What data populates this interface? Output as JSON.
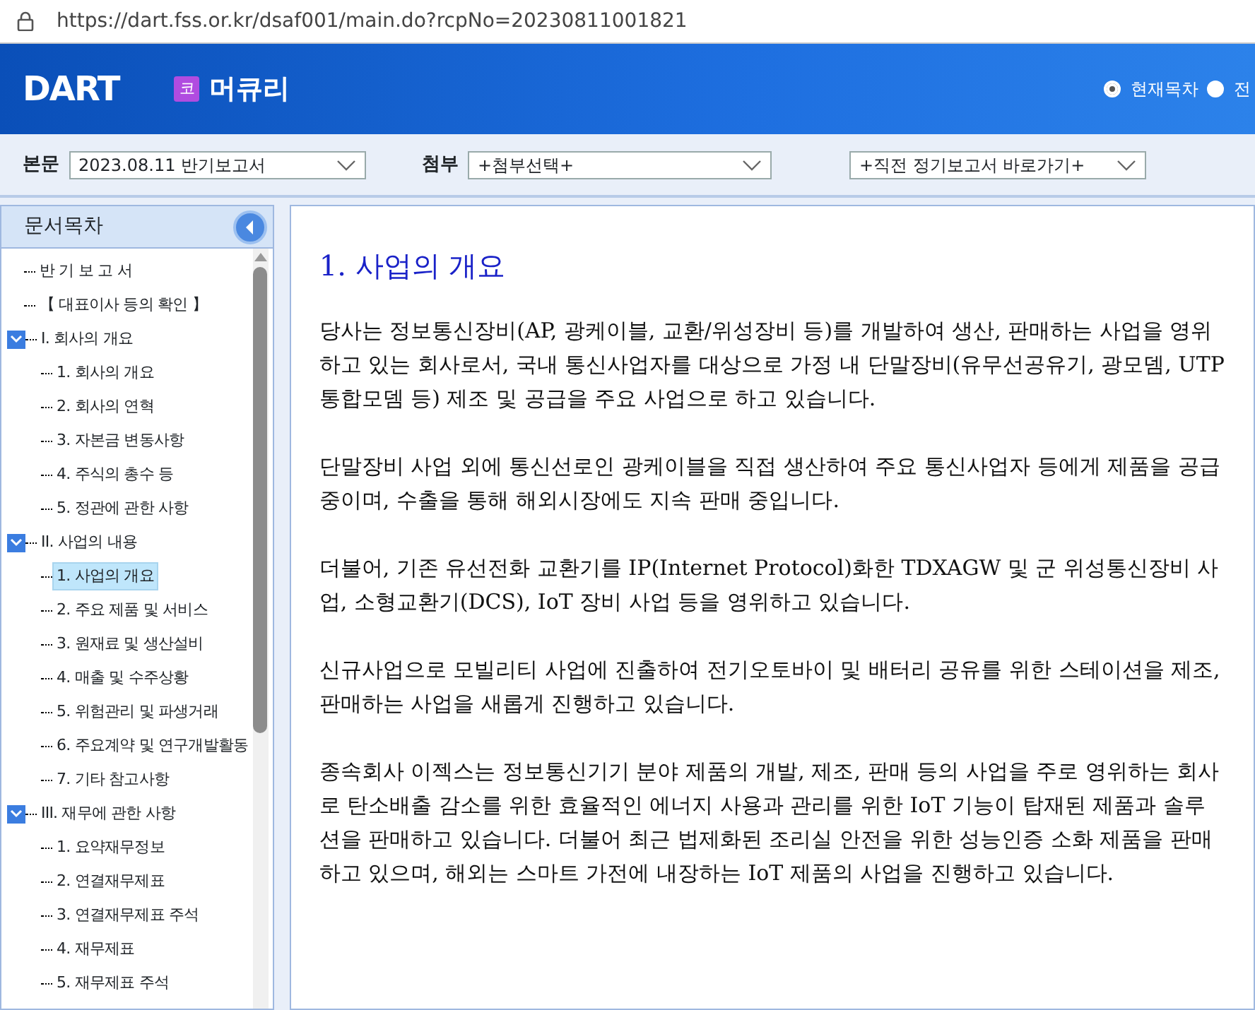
{
  "address_bar": {
    "url": "https://dart.fss.or.kr/dsaf001/main.do?rcpNo=20230811001821"
  },
  "header": {
    "logo": "DART",
    "company_badge": "코",
    "company": "머큐리",
    "view_options": [
      {
        "label": "현재목차",
        "selected": true
      },
      {
        "label": "전",
        "selected": false
      }
    ]
  },
  "selectors": [
    {
      "label": "본문",
      "value": "2023.08.11  반기보고서"
    },
    {
      "label": "첨부",
      "value": "+첨부선택+"
    },
    {
      "value": "+직전 정기보고서 바로가기+"
    }
  ],
  "sidebar": {
    "title": "문서목차",
    "items": [
      {
        "label": "반 기 보 고 서",
        "selected": false
      },
      {
        "label": "【 대표이사 등의 확인 】",
        "selected": false
      },
      {
        "label": "I. 회사의 개요",
        "selected": false,
        "expanded": true,
        "children": [
          {
            "label": "1. 회사의 개요",
            "selected": false
          },
          {
            "label": "2. 회사의 연혁",
            "selected": false
          },
          {
            "label": "3. 자본금 변동사항",
            "selected": false
          },
          {
            "label": "4. 주식의 총수 등",
            "selected": false
          },
          {
            "label": "5. 정관에 관한 사항",
            "selected": false
          }
        ]
      },
      {
        "label": "II. 사업의 내용",
        "selected": false,
        "expanded": true,
        "children": [
          {
            "label": "1. 사업의 개요",
            "selected": true
          },
          {
            "label": "2. 주요 제품 및 서비스",
            "selected": false
          },
          {
            "label": "3. 원재료 및 생산설비",
            "selected": false
          },
          {
            "label": "4. 매출 및 수주상황",
            "selected": false
          },
          {
            "label": "5. 위험관리 및 파생거래",
            "selected": false
          },
          {
            "label": "6. 주요계약 및 연구개발활동",
            "selected": false
          },
          {
            "label": "7. 기타 참고사항",
            "selected": false
          }
        ]
      },
      {
        "label": "III. 재무에 관한 사항",
        "selected": false,
        "expanded": true,
        "children": [
          {
            "label": "1. 요약재무정보",
            "selected": false
          },
          {
            "label": "2. 연결재무제표",
            "selected": false
          },
          {
            "label": "3. 연결재무제표 주석",
            "selected": false
          },
          {
            "label": "4. 재무제표",
            "selected": false
          },
          {
            "label": "5. 재무제표 주석",
            "selected": false
          }
        ]
      }
    ]
  },
  "document": {
    "heading": "1. 사업의 개요",
    "paragraphs": [
      "당사는 정보통신장비(AP, 광케이블, 교환/위성장비 등)를 개발하여 생산, 판매하는 사업을 영위하고 있는 회사로서, 국내 통신사업자를 대상으로 가정 내 단말장비(유무선공유기, 광모뎀, UTP통합모뎀 등) 제조 및 공급을 주요 사업으로 하고 있습니다.",
      "단말장비 사업 외에 통신선로인 광케이블을 직접 생산하여 주요 통신사업자 등에게 제품을 공급 중이며, 수출을 통해 해외시장에도 지속 판매 중입니다.",
      "더불어, 기존 유선전화 교환기를 IP(Internet Protocol)화한 TDXAGW 및 군 위성통신장비 사업, 소형교환기(DCS), IoT 장비 사업 등을 영위하고 있습니다.",
      "신규사업으로 모빌리티 사업에 진출하여 전기오토바이 및 배터리 공유를 위한 스테이션을 제조, 판매하는 사업을 새롭게 진행하고 있습니다.",
      "종속회사 이젝스는 정보통신기기 분야 제품의 개발, 제조, 판매 등의 사업을 주로 영위하는 회사로 탄소배출 감소를 위한  효율적인 에너지 사용과 관리를 위한  IoT 기능이 탑재된 제품과 솔루션을 판매하고 있습니다. 더불어 최근 법제화된 조리실 안전을 위한 성능인증 소화 제품을 판매하고 있으며,  해외는 스마트 가전에 내장하는 IoT 제품의 사업을 진행하고 있습니다."
    ]
  }
}
